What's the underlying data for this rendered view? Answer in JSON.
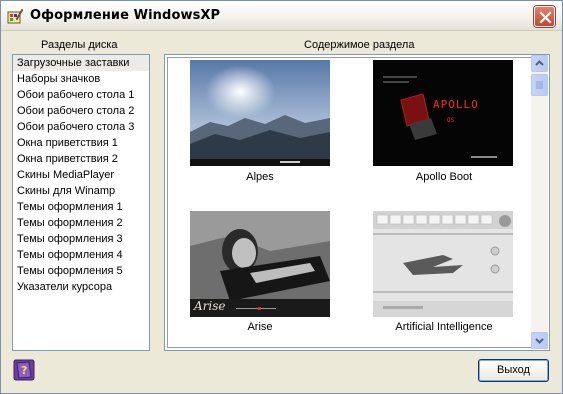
{
  "window": {
    "title": "Оформление WindowsXP",
    "icons": {
      "app": "paint-brush-icon",
      "close": "close-icon",
      "help": "help-book-icon"
    }
  },
  "left_panel": {
    "label": "Разделы диска",
    "items": [
      "Загрузочные заставки",
      "Наборы значков",
      "Обои рабочего стола 1",
      "Обои рабочего стола 2",
      "Обои рабочего стола 3",
      "Окна приветствия 1",
      "Окна приветствия 2",
      "Скины MediaPlayer",
      "Скины для Winamp",
      "Темы оформления 1",
      "Темы оформления 2",
      "Темы оформления 3",
      "Темы оформления 4",
      "Темы оформления 5",
      "Указатели курсора"
    ],
    "selected_index": 0
  },
  "right_panel": {
    "label": "Содержимое раздела",
    "thumbnails": [
      {
        "caption": "Alpes"
      },
      {
        "caption": "Apollo Boot",
        "overlay_text": [
          "APOLLO",
          "OS"
        ]
      },
      {
        "caption": "Arise",
        "overlay_text": [
          "Arise"
        ]
      },
      {
        "caption": "Artificial Intelligence"
      }
    ]
  },
  "buttons": {
    "exit": "Выход"
  },
  "colors": {
    "close_red": "#c6452d",
    "list_border": "#7f9db9",
    "face": "#ece9d8"
  }
}
